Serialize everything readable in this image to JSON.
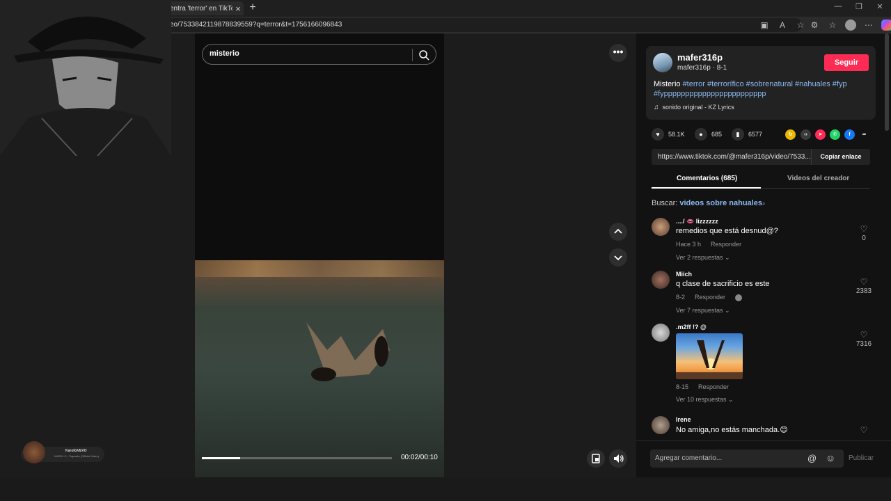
{
  "browser": {
    "tab_title": "entra 'terror' en TikTok |",
    "tab_close": "×",
    "new_tab": "+",
    "url": "eo/7533842119878839559?q=terror&t=1756166096843",
    "minimize": "—",
    "restore": "❐",
    "close": "✕"
  },
  "video": {
    "search_query": "misterio",
    "more": "•••",
    "time": "00:02/00:10",
    "progress": 0.2
  },
  "mini_player": {
    "title": "KarolGVEVO",
    "subtitle": "KAROL G - Papasito (Official Video)"
  },
  "post": {
    "author": "mafer316p",
    "author_sub": "mafer316p · 8-1",
    "follow": "Seguir",
    "desc_text": "Misterio ",
    "desc_tags": "#terror #terrorífico #sobrenatural #nahuales #fyp #fypppppppppppppppppppppppp",
    "music": "sonido original - KZ Lyrics",
    "likes": "58.1K",
    "comments": "685",
    "saves": "6577",
    "link": "https://www.tiktok.com/@mafer316p/video/7533...",
    "copy_link": "Copiar enlace"
  },
  "tabs": {
    "comments": "Comentarios (685)",
    "creator_videos": "Videos del creador"
  },
  "search_hint": {
    "prefix": "Buscar: ",
    "keyword": "videos sobre nahuales"
  },
  "comments": [
    {
      "user": "..../ 👄 lizzzzzz",
      "text": "remedios que está desnud@?",
      "time": "Hace 3 h",
      "reply": "Responder",
      "replies": "Ver 2 respuestas ⌄",
      "likes": "0"
    },
    {
      "user": "Miich",
      "text": "q clase de sacrificio es este",
      "time": "8-2",
      "reply": "Responder",
      "replies": "Ver 7 respuestas ⌄",
      "likes": "2383"
    },
    {
      "user": ".m2ff !? @",
      "text": "",
      "time": "8-15",
      "reply": "Responder",
      "replies": "Ver 10 respuestas ⌄",
      "likes": "7316"
    },
    {
      "user": "Irene",
      "text": "No amiga,no estás manchada.😊",
      "time": "",
      "reply": "",
      "replies": "",
      "likes": ""
    }
  ],
  "comment_bar": {
    "placeholder": "Agregar comentario...",
    "at": "@",
    "emoji": "☺",
    "publish": "Publicar"
  }
}
